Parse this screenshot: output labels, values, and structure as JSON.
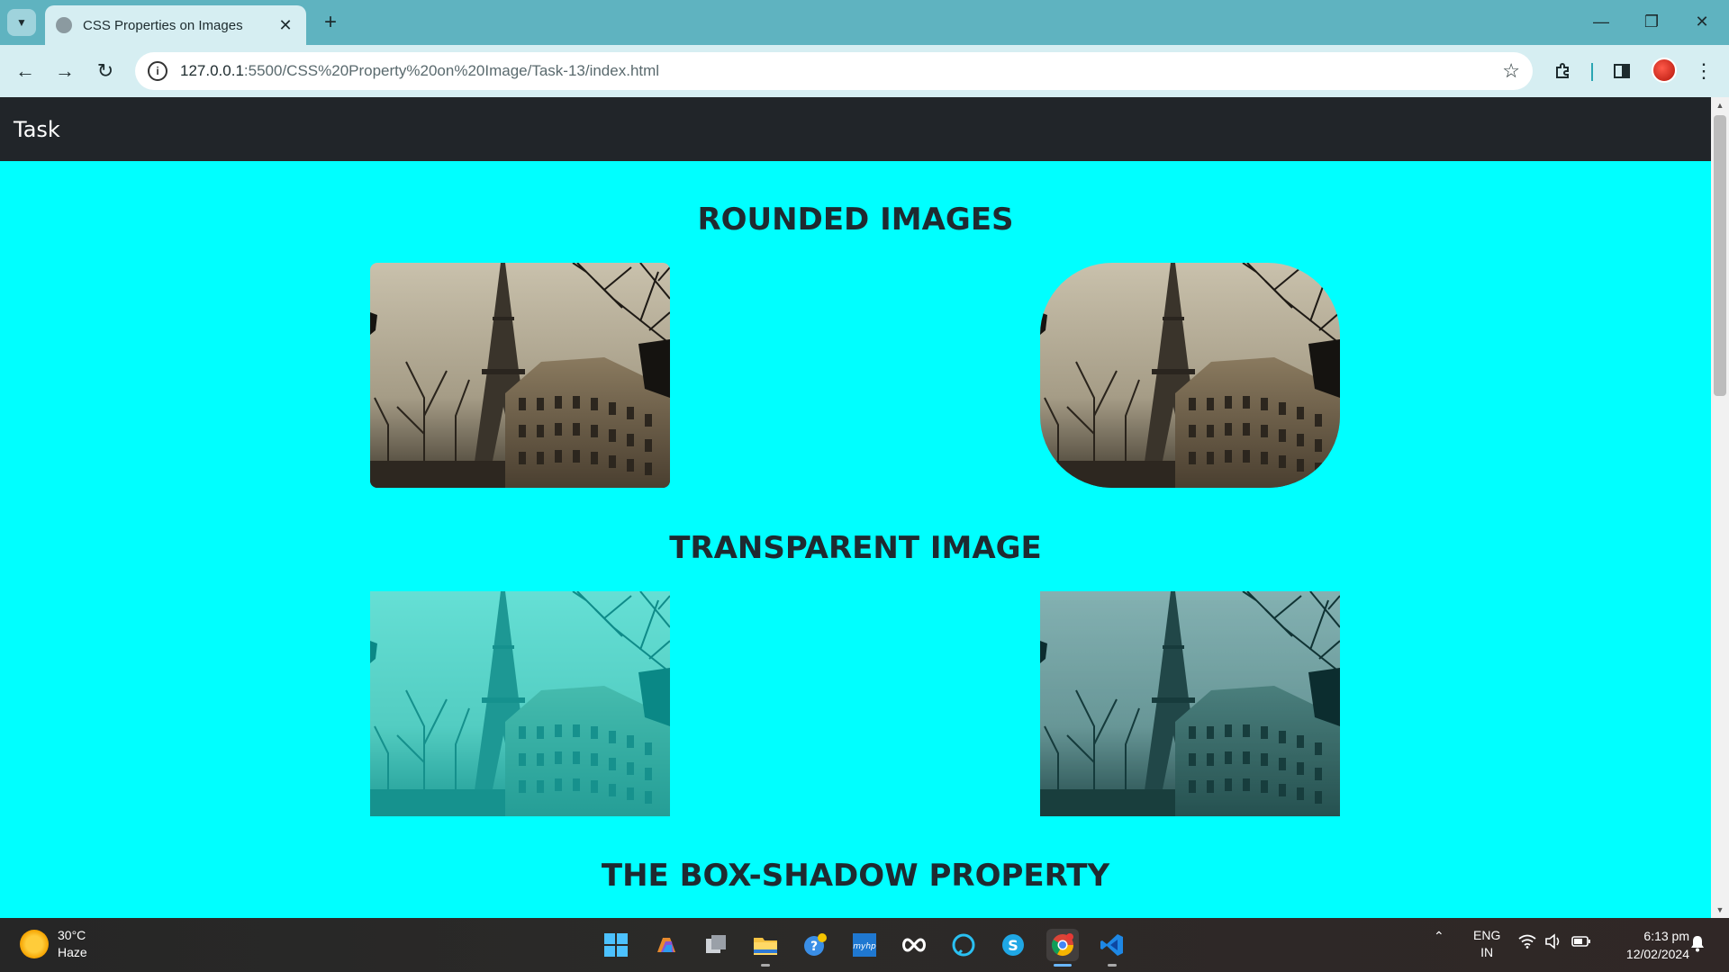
{
  "browser": {
    "tab_title": "CSS Properties on Images",
    "url_host": "127.0.0.1",
    "url_path": ":5500/CSS%20Property%20on%20Image/Task-13/index.html"
  },
  "page": {
    "brand": "Task",
    "sections": [
      {
        "title": "ROUNDED IMAGES"
      },
      {
        "title": "TRANSPARENT IMAGE"
      },
      {
        "title": "THE BOX-SHADOW PROPERTY"
      }
    ]
  },
  "taskbar": {
    "temperature": "30°C",
    "weather": "Haze",
    "lang_1": "ENG",
    "lang_2": "IN",
    "time": "6:13 pm",
    "date": "12/02/2024"
  },
  "colors": {
    "page_bg": "#00ffff",
    "navbar_bg": "#212529",
    "chrome_bg": "#5fb3c0",
    "toolbar_bg": "#d6eef2"
  },
  "icons": {
    "back": "arrow-left-icon",
    "forward": "arrow-right-icon",
    "reload": "reload-icon",
    "bookmark": "star-icon",
    "extensions": "puzzle-icon",
    "side_panel": "side-panel-icon",
    "menu": "kebab-menu-icon"
  }
}
